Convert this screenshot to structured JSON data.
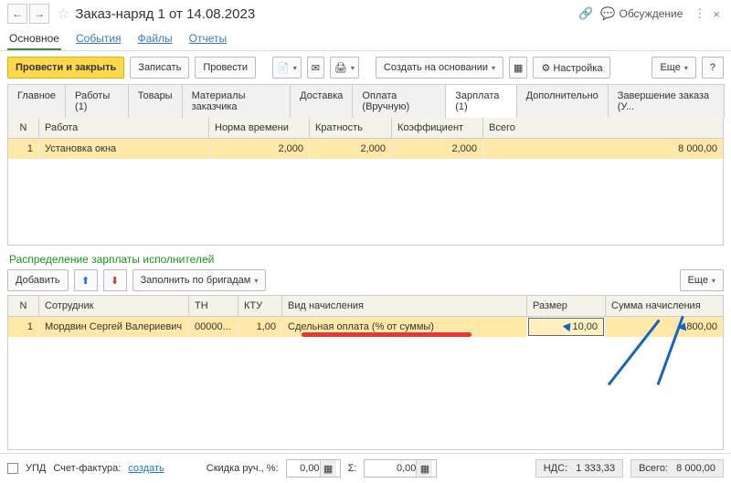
{
  "titlebar": {
    "title": "Заказ-наряд 1 от 14.08.2023",
    "discuss": "Обсуждение"
  },
  "subtabs": {
    "main": "Основное",
    "events": "События",
    "files": "Файлы",
    "reports": "Отчеты"
  },
  "toolbar": {
    "conduct_close": "Провести и закрыть",
    "write": "Записать",
    "conduct": "Провести",
    "create_on": "Создать на основании",
    "setup": "Настройка",
    "more": "Еще"
  },
  "tabs": {
    "main": "Главное",
    "works": "Работы (1)",
    "goods": "Товары",
    "mats": "Материалы заказчика",
    "delivery": "Доставка",
    "payment": "Оплата (Вручную)",
    "salary": "Зарплата (1)",
    "extra": "Дополнительно",
    "finish": "Завершение заказа (У..."
  },
  "grid1": {
    "hdr": {
      "n": "N",
      "work": "Работа",
      "norm": "Норма времени",
      "mult": "Кратность",
      "coef": "Коэффициент",
      "total": "Всего"
    },
    "row": {
      "n": "1",
      "work": "Установка окна",
      "norm": "2,000",
      "mult": "2,000",
      "coef": "2,000",
      "total": "8 000,00"
    }
  },
  "section": {
    "title": "Распределение зарплаты исполнителей"
  },
  "toolbar2": {
    "add": "Добавить",
    "fill": "Заполнить по бригадам",
    "more": "Еще"
  },
  "grid2": {
    "hdr": {
      "n": "N",
      "emp": "Сотрудник",
      "tn": "ТН",
      "ktu": "КТУ",
      "type": "Вид начисления",
      "size": "Размер",
      "sum": "Сумма начисления"
    },
    "row": {
      "n": "1",
      "emp": "Мордвин Сергей Валериевич",
      "tn": "00000...",
      "ktu": "1,00",
      "type": "Сдельная оплата (% от суммы)",
      "size": "10,00",
      "sum": "800,00"
    }
  },
  "footer": {
    "upd": "УПД",
    "sf": "Счет-фактура:",
    "create": "создать",
    "disc": "Скидка руч., %:",
    "disc_val": "0,00",
    "sigma": "Σ:",
    "sigma_val": "0,00",
    "nds": "НДС:",
    "nds_val": "1 333,33",
    "total": "Всего:",
    "total_val": "8 000,00"
  }
}
